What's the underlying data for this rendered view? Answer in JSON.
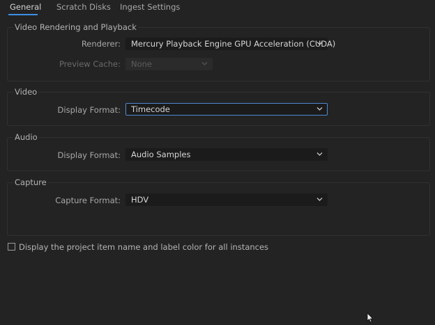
{
  "tabs": [
    {
      "label": "General",
      "active": true
    },
    {
      "label": "Scratch Disks",
      "active": false
    },
    {
      "label": "Ingest Settings",
      "active": false
    }
  ],
  "video_rendering": {
    "title": "Video Rendering and Playback",
    "renderer_label": "Renderer:",
    "renderer_value": "Mercury Playback Engine GPU Acceleration (CUDA)",
    "preview_cache_label": "Preview Cache:",
    "preview_cache_value": "None"
  },
  "video": {
    "title": "Video",
    "display_format_label": "Display Format:",
    "display_format_value": "Timecode"
  },
  "audio": {
    "title": "Audio",
    "display_format_label": "Display Format:",
    "display_format_value": "Audio Samples"
  },
  "capture": {
    "title": "Capture",
    "capture_format_label": "Capture Format:",
    "capture_format_value": "HDV"
  },
  "options": {
    "show_label_color_label": "Display the project item name and label color for all instances",
    "show_label_color_checked": false
  },
  "colors": {
    "background": "#232323",
    "accent": "#3d8ee6",
    "field": "#1b1b1b"
  },
  "icons": {
    "dropdown": "chevron-down-icon",
    "pointer": "mouse-cursor-icon"
  }
}
